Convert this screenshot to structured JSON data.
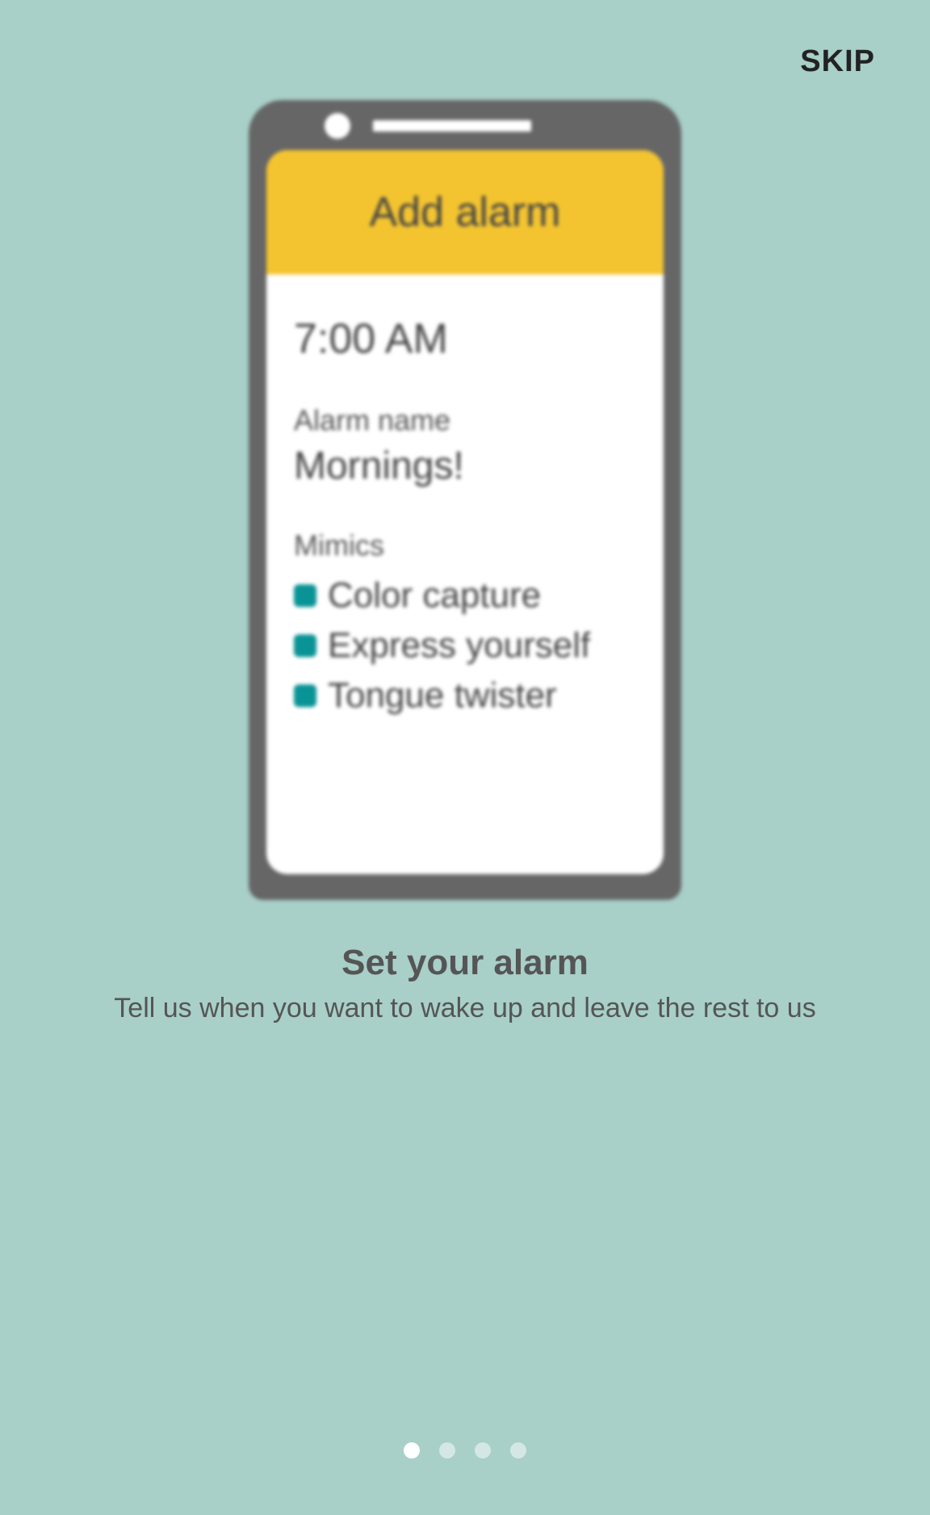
{
  "skip_label": "SKIP",
  "phone": {
    "header_title": "Add alarm",
    "time": "7:00 AM",
    "alarm_name_label": "Alarm name",
    "alarm_name_value": "Mornings!",
    "mimics_label": "Mimics",
    "mimics": [
      "Color capture",
      "Express yourself",
      "Tongue twister"
    ]
  },
  "onboarding": {
    "title": "Set your alarm",
    "subtitle": "Tell us when you want to wake up and leave the rest to us"
  },
  "pagination": {
    "total": 4,
    "active_index": 0
  }
}
